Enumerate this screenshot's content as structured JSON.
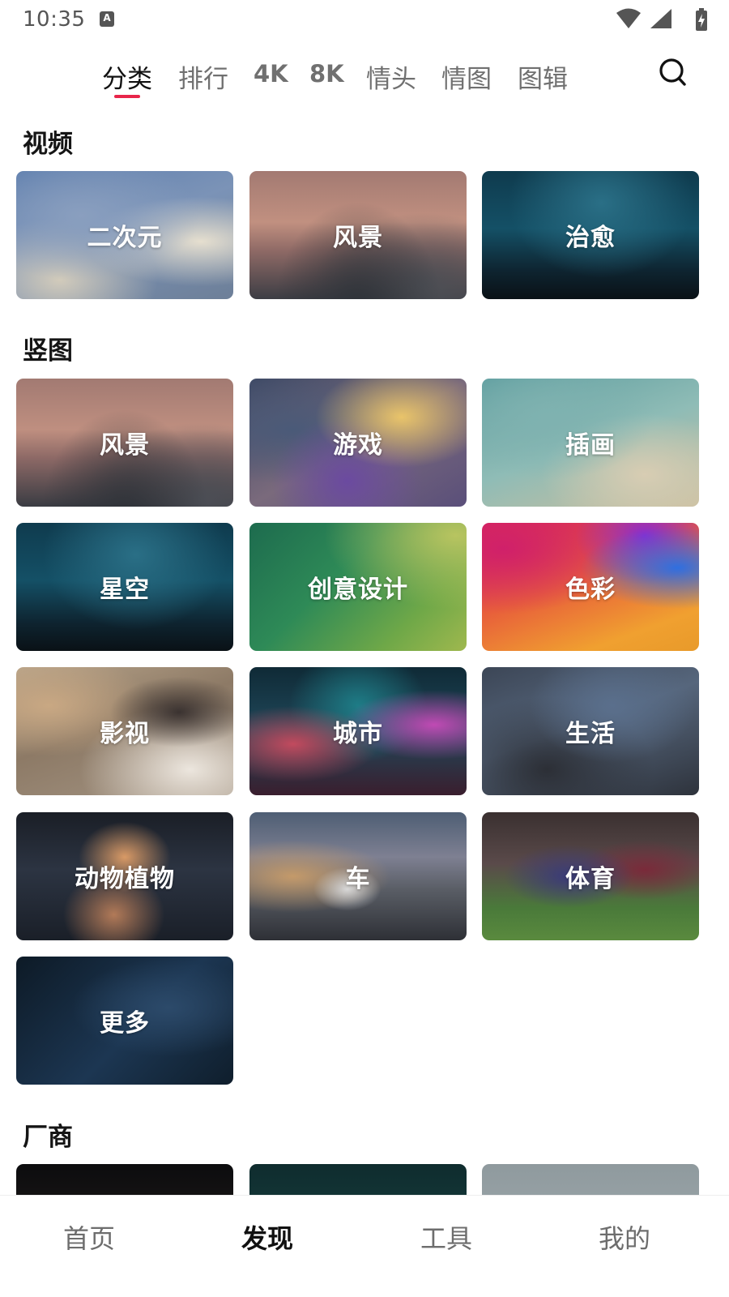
{
  "status": {
    "time": "10:35",
    "notification_icon": "A"
  },
  "top_tabs": [
    {
      "label": "分类",
      "active": true
    },
    {
      "label": "排行",
      "active": false
    },
    {
      "label": "4K",
      "active": false
    },
    {
      "label": "8K",
      "active": false
    },
    {
      "label": "情头",
      "active": false
    },
    {
      "label": "情图",
      "active": false
    },
    {
      "label": "图辑",
      "active": false
    }
  ],
  "accent_color": "#e8254a",
  "sections": {
    "video": {
      "title": "视频",
      "items": [
        "二次元",
        "风景",
        "治愈"
      ]
    },
    "vertical": {
      "title": "竖图",
      "items": [
        "风景",
        "游戏",
        "插画",
        "星空",
        "创意设计",
        "色彩",
        "影视",
        "城市",
        "生活",
        "动物植物",
        "车",
        "体育",
        "更多"
      ]
    },
    "vendor": {
      "title": "厂商"
    }
  },
  "bottom_nav": [
    {
      "label": "首页",
      "active": false
    },
    {
      "label": "发现",
      "active": true
    },
    {
      "label": "工具",
      "active": false
    },
    {
      "label": "我的",
      "active": false
    }
  ]
}
